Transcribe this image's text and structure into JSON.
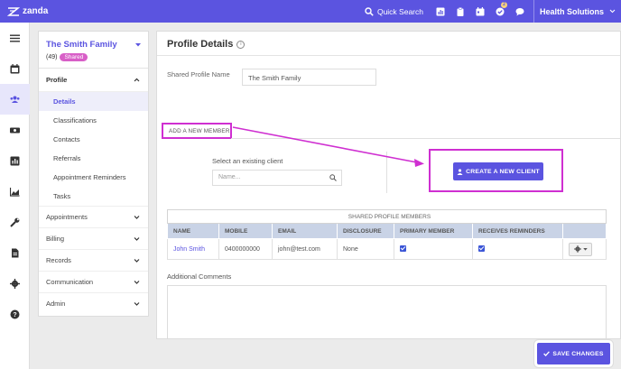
{
  "app": {
    "logo_text": "zanda"
  },
  "topbar": {
    "search_label": "Quick Search",
    "notification_count": "2",
    "org_name": "Health Solutions"
  },
  "sidebar": {
    "client_name": "The Smith Family",
    "client_count": "(49)",
    "shared_badge": "Shared",
    "profile_label": "Profile",
    "profile_items": [
      "Details",
      "Classifications",
      "Contacts",
      "Referrals",
      "Appointment Reminders",
      "Tasks"
    ],
    "groups": [
      "Appointments",
      "Billing",
      "Records",
      "Communication",
      "Admin"
    ]
  },
  "main": {
    "title": "Profile Details",
    "shared_profile_name_label": "Shared Profile Name",
    "shared_profile_name_value": "The Smith Family",
    "add_member_label": "ADD A NEW MEMBER",
    "select_existing_label": "Select an existing client",
    "select_placeholder": "Name...",
    "create_button": "CREATE A NEW CLIENT",
    "table": {
      "caption": "SHARED PROFILE MEMBERS",
      "headers": [
        "NAME",
        "MOBILE",
        "EMAIL",
        "DISCLOSURE",
        "PRIMARY MEMBER",
        "RECEIVES REMINDERS",
        ""
      ],
      "rows": [
        {
          "name": "John Smith",
          "mobile": "0400000000",
          "email": "john@test.com",
          "disclosure": "None",
          "primary": true,
          "reminders": true
        }
      ]
    },
    "comments_label": "Additional Comments"
  },
  "footer": {
    "save_button": "SAVE CHANGES"
  },
  "colors": {
    "accent": "#5b54e0",
    "annotation": "#cf2fd1",
    "badge": "#d85fc7",
    "table_header": "#c9d3e6"
  }
}
